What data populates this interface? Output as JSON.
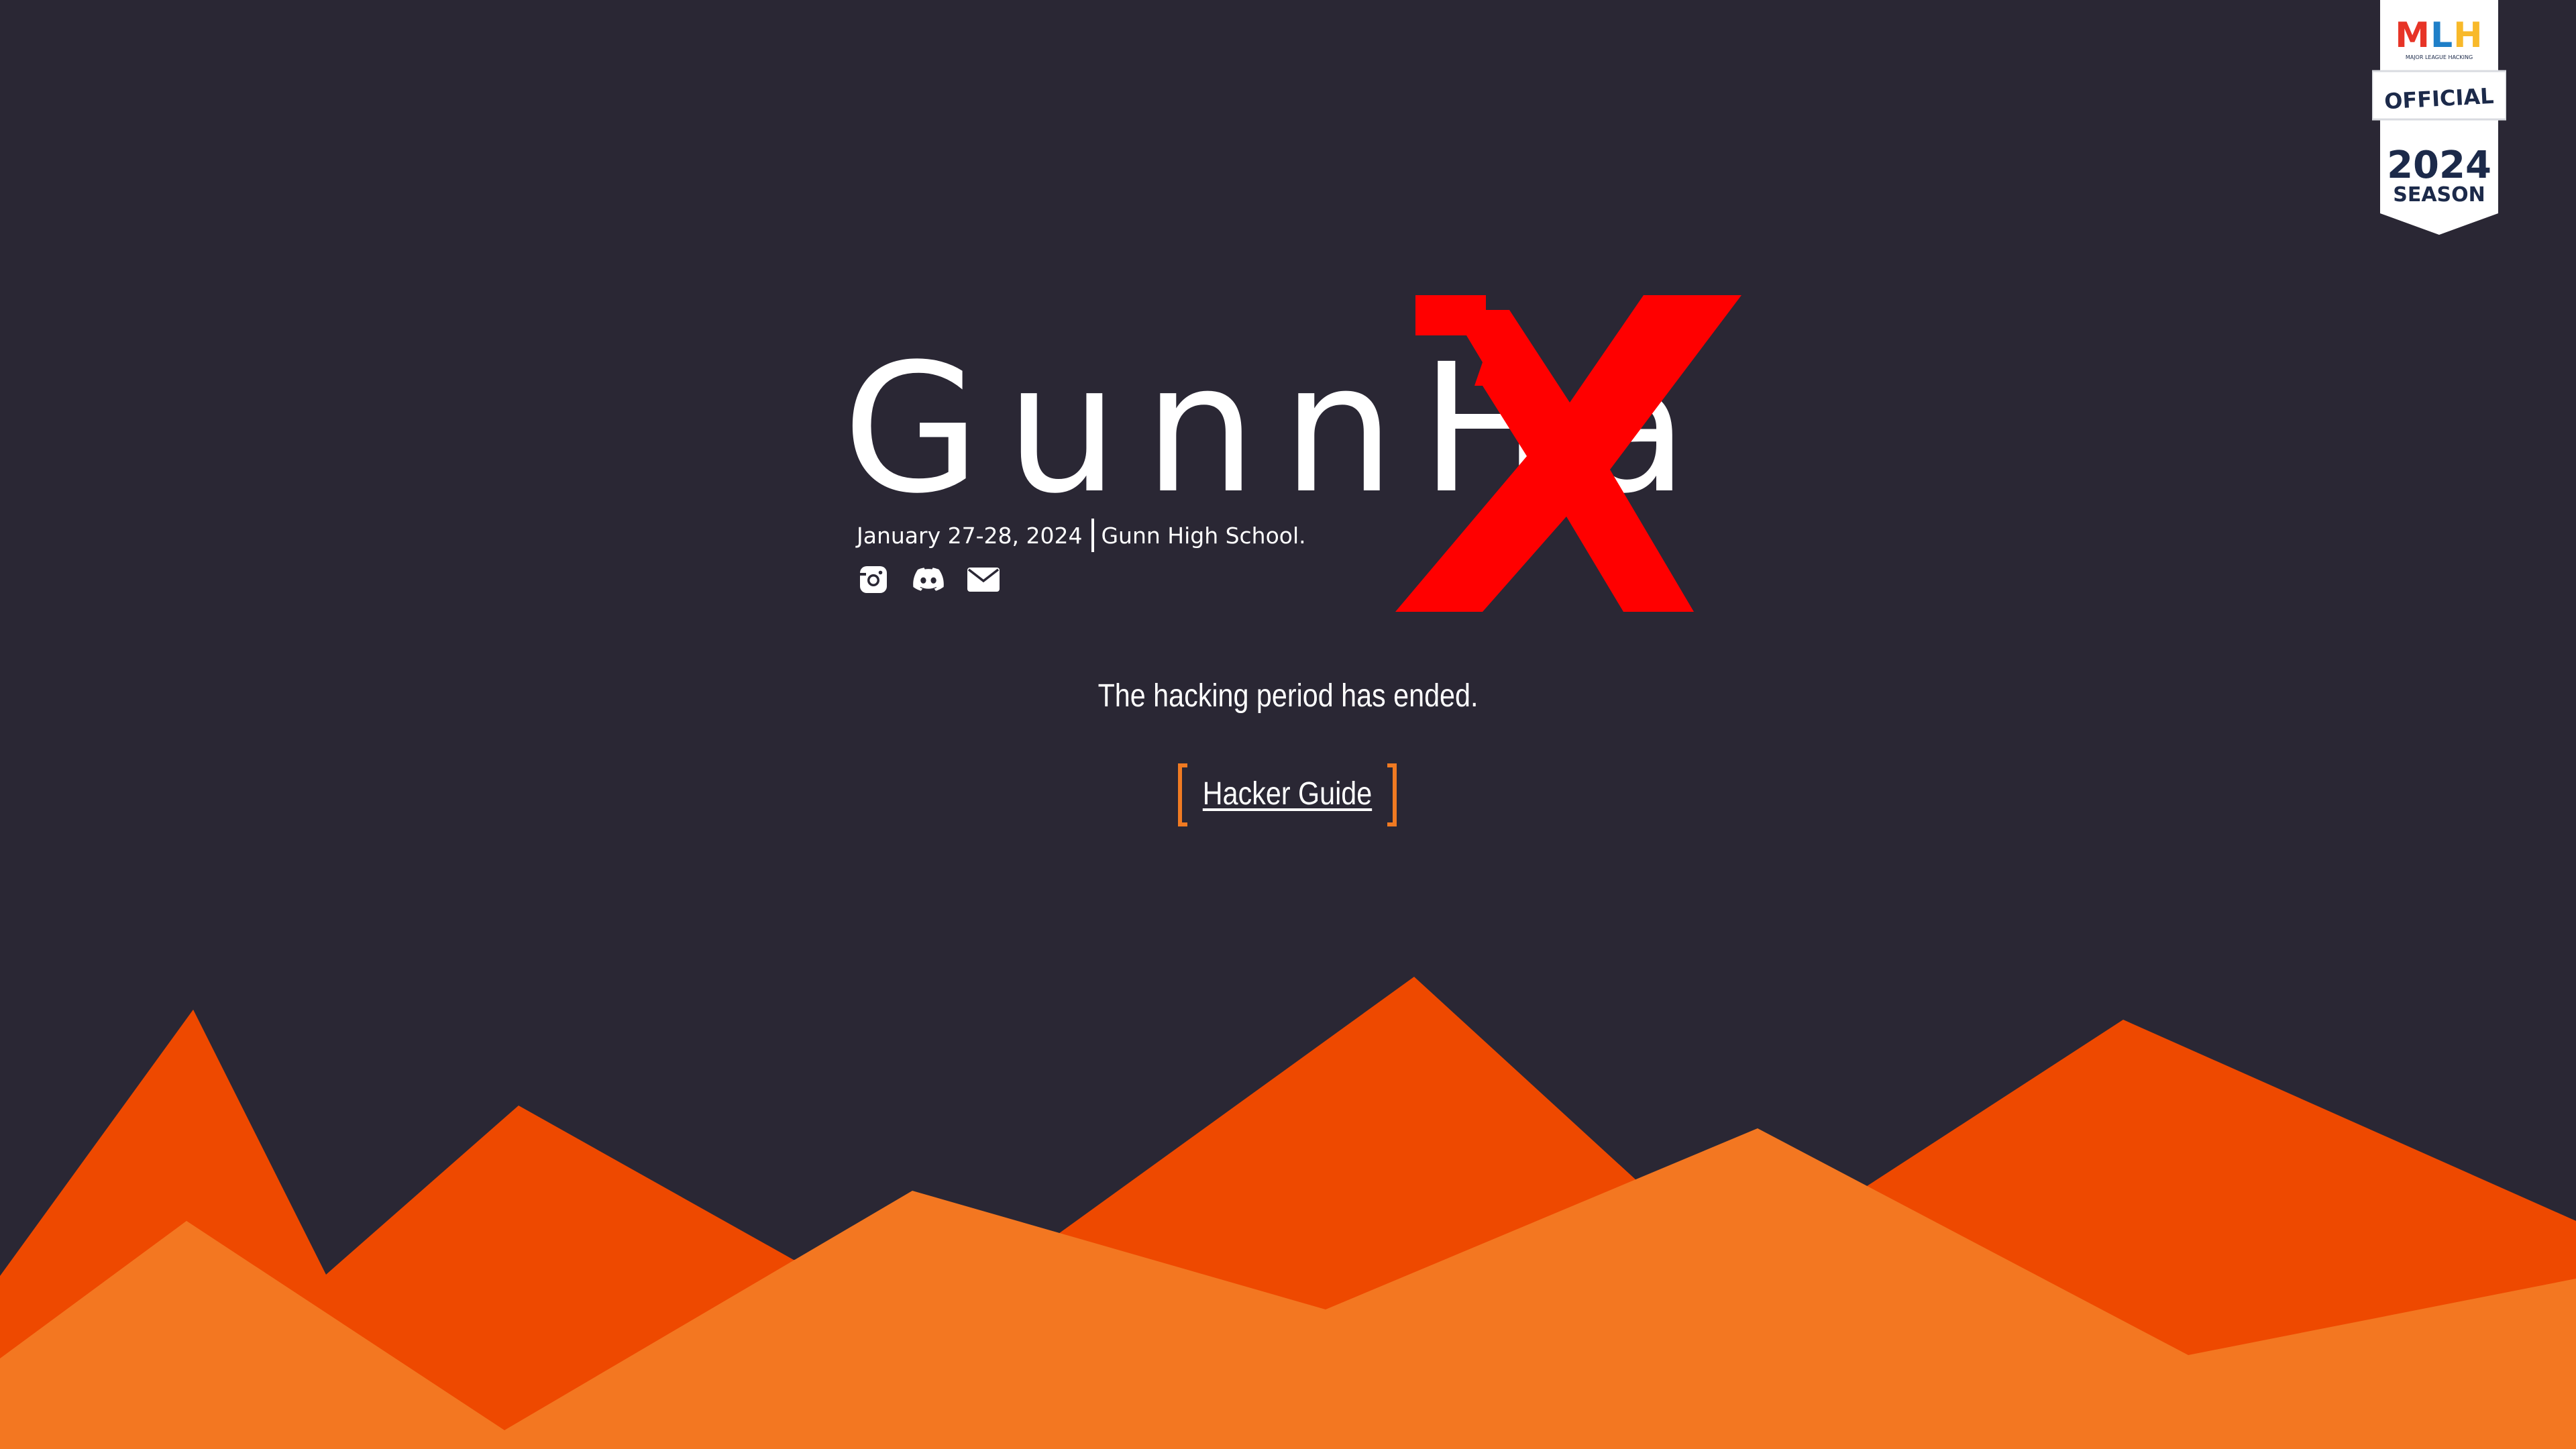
{
  "logo": {
    "wordmark": "GunnHa",
    "mark_icon": "red-x-logo-icon",
    "mark_color": "#ff0000"
  },
  "event": {
    "dates": "January 27-28, 2024",
    "location": "Gunn High School."
  },
  "socials": [
    {
      "name": "instagram-icon"
    },
    {
      "name": "discord-icon"
    },
    {
      "name": "email-icon"
    }
  ],
  "status": "The hacking period has ended.",
  "guide_link": "Hacker Guide",
  "mlh_badge": {
    "logo": "MLH",
    "tagline": "MAJOR LEAGUE HACKING",
    "official": "OFFICIAL",
    "year": "2024",
    "season": "SEASON"
  },
  "colors": {
    "background": "#2a2734",
    "mountain_back": "#ee4900",
    "mountain_front": "#f37721",
    "accent": "#f07a22",
    "text": "#ffffff"
  }
}
